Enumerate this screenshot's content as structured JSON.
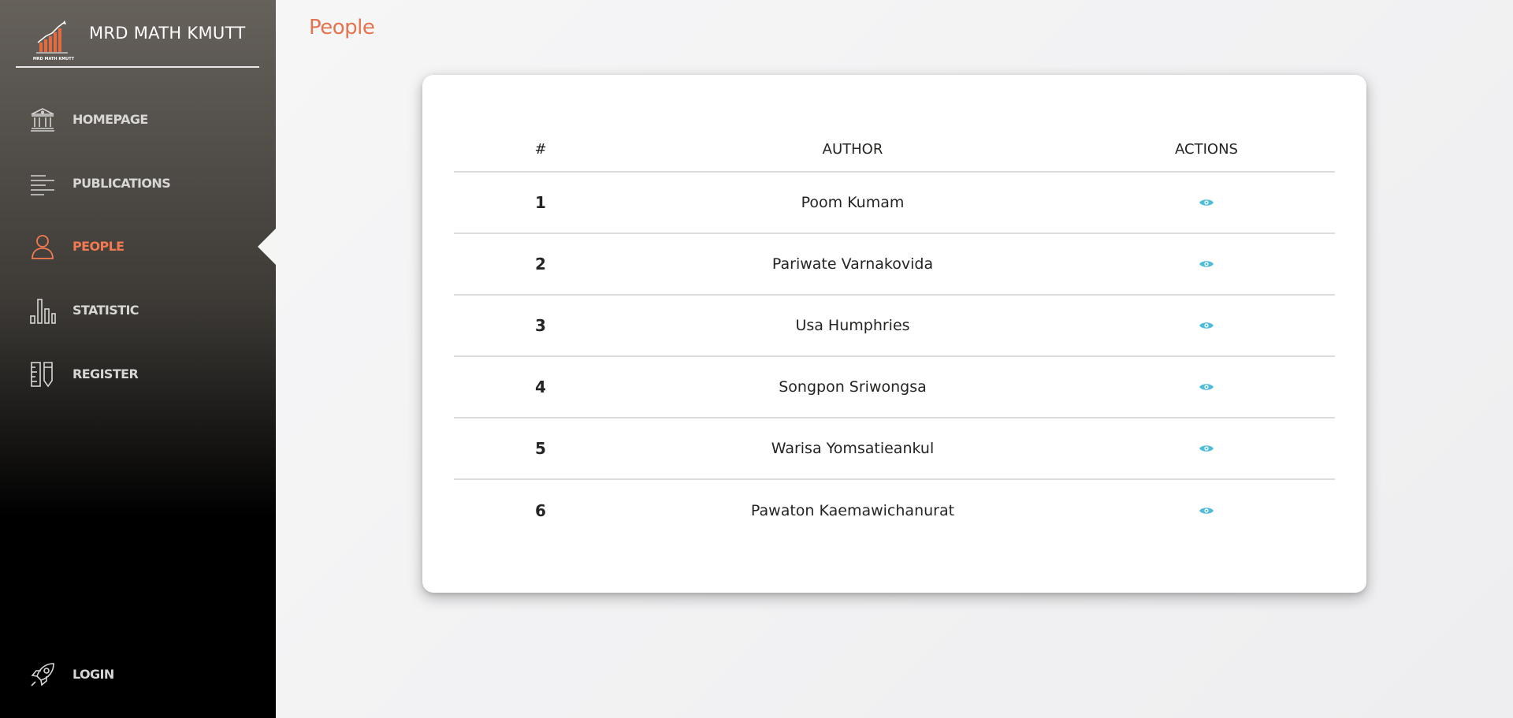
{
  "brand": {
    "name": "MRD MATH KMUTT",
    "logo_text": "MRD MATH KMUTT"
  },
  "sidebar": {
    "items": [
      {
        "label": "HOMEPAGE",
        "icon": "bank-icon"
      },
      {
        "label": "PUBLICATIONS",
        "icon": "text-align-icon"
      },
      {
        "label": "PEOPLE",
        "icon": "user-icon",
        "active": true
      },
      {
        "label": "STATISTIC",
        "icon": "bar-chart-icon"
      },
      {
        "label": "REGISTER",
        "icon": "ruler-pencil-icon"
      }
    ],
    "login": {
      "label": "LOGIN",
      "icon": "rocket-icon"
    }
  },
  "page": {
    "title": "People"
  },
  "table": {
    "headers": [
      "#",
      "AUTHOR",
      "ACTIONS"
    ],
    "rows": [
      {
        "num": "1",
        "author": "Poom Kumam"
      },
      {
        "num": "2",
        "author": "Pariwate Varnakovida"
      },
      {
        "num": "3",
        "author": "Usa Humphries"
      },
      {
        "num": "4",
        "author": "Songpon Sriwongsa"
      },
      {
        "num": "5",
        "author": "Warisa Yomsatieankul"
      },
      {
        "num": "6",
        "author": "Pawaton Kaemawichanurat"
      }
    ],
    "action_icon": "eye-icon"
  },
  "colors": {
    "accent": "#f27a52",
    "title": "#e3744f",
    "action": "#51bcda",
    "sidebar_text": "#d7d6d5"
  }
}
